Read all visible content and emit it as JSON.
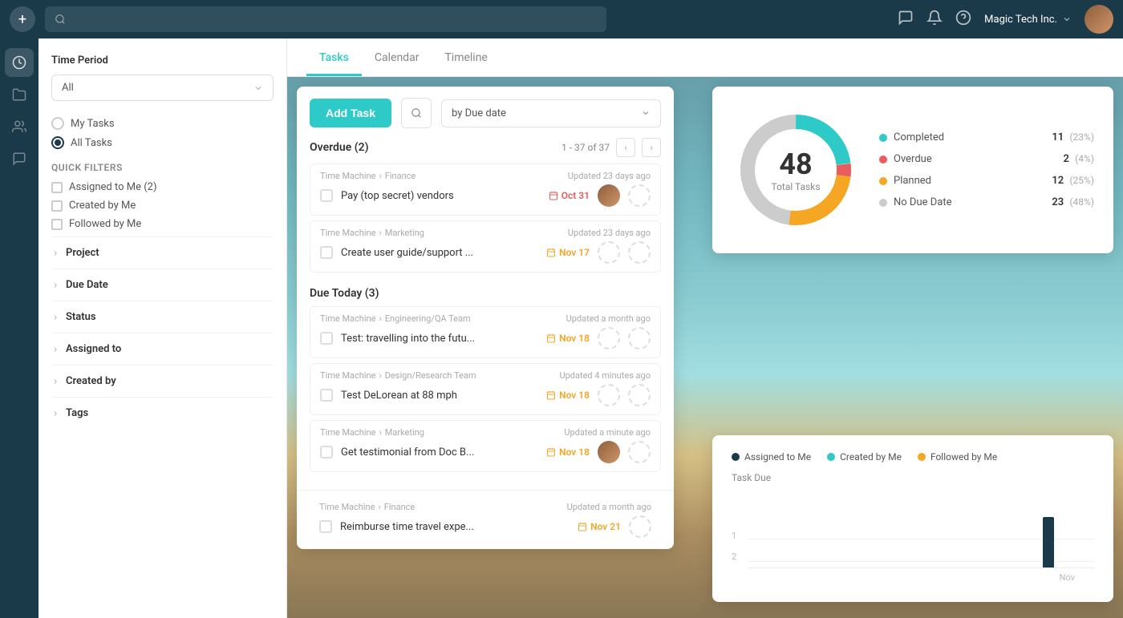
{
  "topNav": {
    "addLabel": "+",
    "searchPlaceholder": "Search",
    "company": "Magic Tech Inc.",
    "icons": {
      "chat": "💬",
      "bell": "🔔",
      "help": "?"
    }
  },
  "sidebarIcons": [
    {
      "name": "clock-icon",
      "symbol": "⏱",
      "active": true
    },
    {
      "name": "folder-icon",
      "symbol": "📁",
      "active": false
    },
    {
      "name": "users-icon",
      "symbol": "👥",
      "active": false
    },
    {
      "name": "chat-icon",
      "symbol": "💬",
      "active": false
    }
  ],
  "filterSidebar": {
    "timePeriodLabel": "Time Period",
    "timePeriodValue": "All",
    "taskTypeOptions": [
      {
        "label": "My Tasks",
        "selected": false
      },
      {
        "label": "All Tasks",
        "selected": true
      }
    ],
    "quickFiltersTitle": "Quick filters",
    "quickFilters": [
      {
        "label": "Assigned to Me (2)",
        "checked": false
      },
      {
        "label": "Created by Me",
        "checked": false
      },
      {
        "label": "Followed by Me",
        "checked": false
      }
    ],
    "expandableSections": [
      {
        "label": "Project"
      },
      {
        "label": "Due Date"
      },
      {
        "label": "Status"
      },
      {
        "label": "Assigned to"
      },
      {
        "label": "Created by"
      },
      {
        "label": "Tags"
      }
    ]
  },
  "tabs": [
    {
      "label": "Tasks",
      "active": true
    },
    {
      "label": "Calendar",
      "active": false
    },
    {
      "label": "Timeline",
      "active": false
    }
  ],
  "taskPanel": {
    "addTaskLabel": "Add Task",
    "sortLabel": "by Due date",
    "searchIcon": "🔍",
    "overdue": {
      "title": "Overdue (2)",
      "pagination": "1 - 37 of 37",
      "tasks": [
        {
          "project": "Time Machine",
          "section": "Finance",
          "updated": "Updated 23 days ago",
          "title": "Pay (top secret) vendors",
          "dueDate": "Oct 31",
          "dueDateClass": "overdue",
          "hasAssignee": true
        },
        {
          "project": "Time Machine",
          "section": "Marketing",
          "updated": "Updated 23 days ago",
          "title": "Create user guide/support ...",
          "dueDate": "Nov 17",
          "dueDateClass": "upcoming",
          "hasAssignee": false
        }
      ]
    },
    "dueToday": {
      "title": "Due Today (3)",
      "tasks": [
        {
          "project": "Time Machine",
          "section": "Engineering/QA Team",
          "updated": "Updated a month ago",
          "title": "Test: travelling into the futu...",
          "dueDate": "Nov 18",
          "dueDateClass": "upcoming",
          "hasAssignee": false
        },
        {
          "project": "Time Machine",
          "section": "Design/Research Team",
          "updated": "Updated 4 minutes ago",
          "title": "Test DeLorean at 88 mph",
          "dueDate": "Nov 18",
          "dueDateClass": "upcoming",
          "hasAssignee": false
        },
        {
          "project": "Time Machine",
          "section": "Marketing",
          "updated": "Updated a minute ago",
          "title": "Get testimonial from Doc B...",
          "dueDate": "Nov 18",
          "dueDateClass": "upcoming",
          "hasAssignee": true
        }
      ]
    },
    "nextTask": {
      "project": "Time Machine",
      "section": "Finance",
      "updated": "Updated a month ago",
      "title": "Reimburse time travel expe...",
      "dueDate": "Nov 21",
      "dueDateClass": "upcoming",
      "hasAssignee": false
    }
  },
  "statsPanel": {
    "totalTasks": "48",
    "totalTasksLabel": "Total Tasks",
    "donut": {
      "segments": [
        {
          "label": "Completed",
          "color": "#2ecac8",
          "value": 11,
          "pct": "23%",
          "degrees": 83
        },
        {
          "label": "Overdue",
          "color": "#e85d5d",
          "value": 2,
          "pct": "4%",
          "degrees": 14
        },
        {
          "label": "Planned",
          "color": "#f5a623",
          "value": 12,
          "pct": "25%",
          "degrees": 90
        },
        {
          "label": "No Due Date",
          "color": "#ccc",
          "value": 23,
          "pct": "48%",
          "degrees": 173
        }
      ]
    },
    "legend": [
      {
        "label": "Completed",
        "color": "#2ecac8",
        "count": "11",
        "pct": "(23%)"
      },
      {
        "label": "Overdue",
        "color": "#e85d5d",
        "count": "2",
        "pct": "(4%)"
      },
      {
        "label": "Planned",
        "color": "#f5a623",
        "count": "12",
        "pct": "(25%)"
      },
      {
        "label": "No Due Date",
        "color": "#ccc",
        "count": "23",
        "pct": "(48%)"
      }
    ]
  },
  "chartPanel": {
    "legend": [
      {
        "label": "Assigned to Me",
        "color": "#1a3a4a"
      },
      {
        "label": "Created by Me",
        "color": "#2ecac8"
      },
      {
        "label": "Followed by Me",
        "color": "#f5a623"
      }
    ],
    "taskDueLabel": "Task Due",
    "yAxis": [
      {
        "value": "2",
        "pct": 66
      },
      {
        "value": "1",
        "pct": 33
      }
    ],
    "bars": [
      {
        "x": "",
        "values": [
          0,
          0,
          0
        ]
      },
      {
        "x": "",
        "values": [
          0,
          0,
          0
        ]
      },
      {
        "x": "",
        "values": [
          0,
          0,
          0
        ]
      },
      {
        "x": "",
        "values": [
          0,
          0,
          0
        ]
      },
      {
        "x": "",
        "values": [
          0,
          0,
          0
        ]
      },
      {
        "x": "Nov",
        "values": [
          2,
          0,
          0
        ]
      }
    ]
  }
}
